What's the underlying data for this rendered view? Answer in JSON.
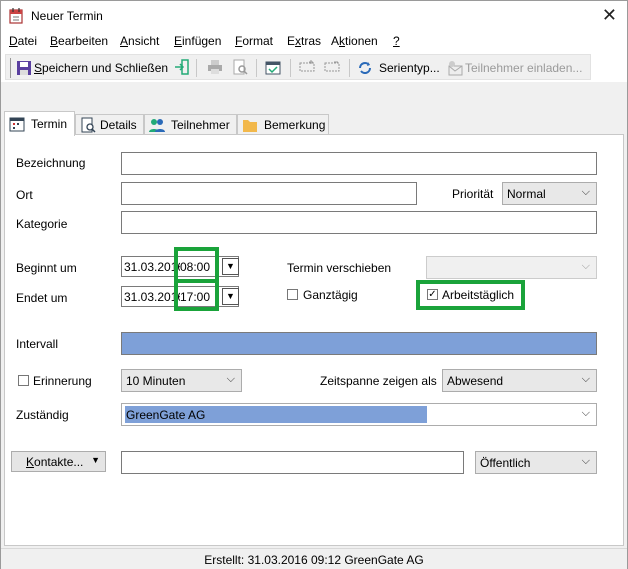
{
  "window": {
    "title": "Neuer Termin"
  },
  "menu": [
    {
      "pre": "",
      "u": "D",
      "post": "atei"
    },
    {
      "pre": "",
      "u": "B",
      "post": "earbeiten"
    },
    {
      "pre": "",
      "u": "A",
      "post": "nsicht"
    },
    {
      "pre": "",
      "u": "E",
      "post": "infügen"
    },
    {
      "pre": "",
      "u": "F",
      "post": "ormat"
    },
    {
      "pre": "E",
      "u": "x",
      "post": "tras"
    },
    {
      "pre": "A",
      "u": "k",
      "post": "tionen"
    },
    {
      "pre": "",
      "u": "?",
      "post": ""
    }
  ],
  "toolbar": {
    "save_pre": "",
    "save_u": "S",
    "save_post": "peichern und Schließen",
    "series_label": "Serientyp...",
    "invite_label": "Teilnehmer einladen..."
  },
  "tabs": [
    "Termin",
    "Details",
    "Teilnehmer",
    "Bemerkung"
  ],
  "form": {
    "bezeichnung_label": "Bezeichnung",
    "bezeichnung_value": "",
    "ort_label": "Ort",
    "ort_value": "",
    "prioritaet_label": "Priorität",
    "prioritaet_value": "Normal",
    "kategorie_label": "Kategorie",
    "kategorie_value": "",
    "beginnt_label": "Beginnt um",
    "beginnt_date": "31.03.2016",
    "beginnt_time": "08:00",
    "endet_label": "Endet um",
    "endet_date": "31.03.2016",
    "endet_time": "17:00",
    "verschieben_label": "Termin verschieben",
    "verschieben_value": "",
    "ganztaegig_label": "Ganztägig",
    "ganztaegig_checked": false,
    "arbeitstaeglich_label": "Arbeitstäglich",
    "arbeitstaeglich_checked": true,
    "intervall_label": "Intervall",
    "erinnerung_label": "Erinnerung",
    "erinnerung_checked": false,
    "erinnerung_value": "10 Minuten",
    "zeitspanne_label": "Zeitspanne zeigen als",
    "zeitspanne_value": "Abwesend",
    "zustaendig_label": "Zuständig",
    "zustaendig_value": "GreenGate AG",
    "kontakte_pre": "",
    "kontakte_u": "K",
    "kontakte_post": "ontakte...",
    "kontakte_value": "",
    "sichtbarkeit_value": "Öffentlich"
  },
  "status": {
    "text": "Erstellt: 31.03.2016 09:12 GreenGate AG"
  },
  "colors": {
    "highlight": "#1aa33a",
    "selection": "#7ea0d8"
  }
}
